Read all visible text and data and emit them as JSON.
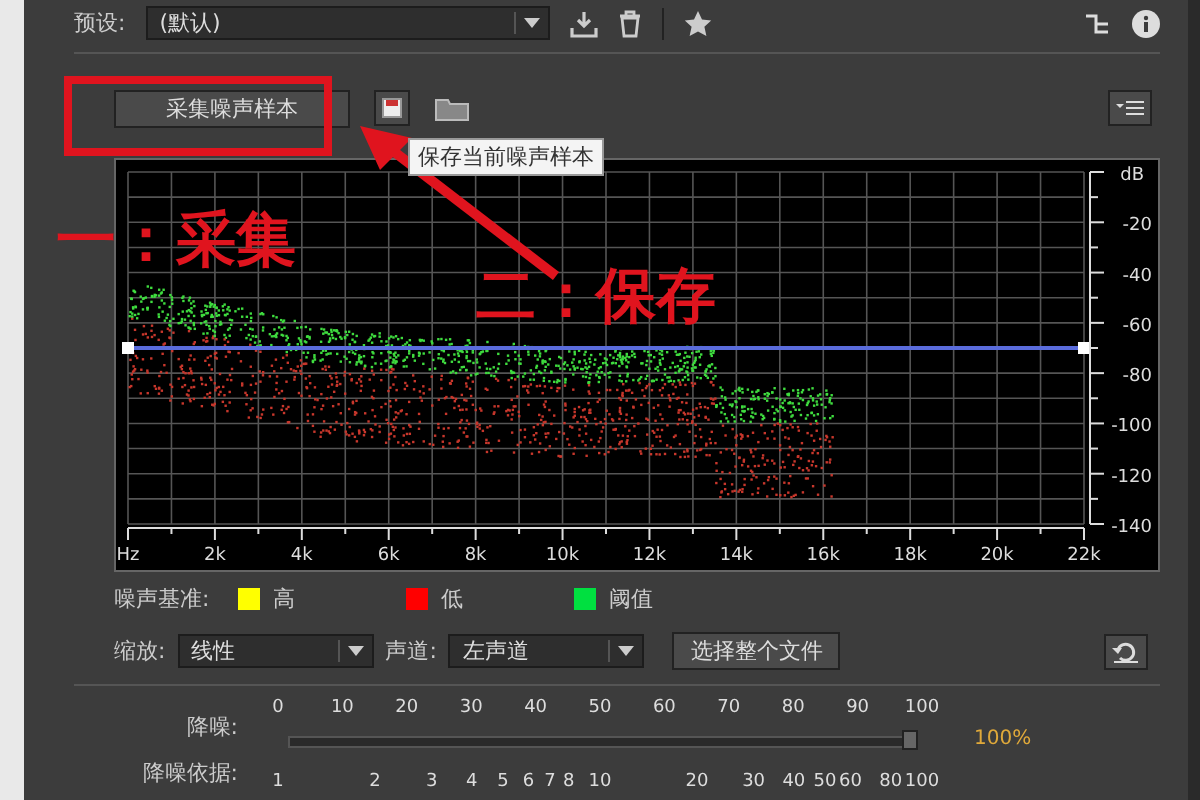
{
  "preset": {
    "label": "预设:",
    "value": "(默认)"
  },
  "noise_print": {
    "capture_button": "采集噪声样本",
    "tooltip": "保存当前噪声样本"
  },
  "spectrum": {
    "y_unit": "dB",
    "y_labels": [
      "-20",
      "-40",
      "-60",
      "-80",
      "-100",
      "-120",
      "-140"
    ],
    "x_labels": [
      "Hz",
      "2k",
      "4k",
      "6k",
      "8k",
      "10k",
      "12k",
      "14k",
      "16k",
      "18k",
      "20k",
      "22k"
    ]
  },
  "legend": {
    "label": "噪声基准:",
    "items": [
      {
        "text": "高",
        "color": "#ffff00"
      },
      {
        "text": "低",
        "color": "#ff0000"
      },
      {
        "text": "阈值",
        "color": "#00e040"
      }
    ]
  },
  "scale": {
    "label": "缩放:",
    "value": "线性"
  },
  "channel": {
    "label": "声道:",
    "value": "左声道"
  },
  "select_file_button": "选择整个文件",
  "noise_reduction": {
    "label": "降噪:",
    "ticks": [
      "0",
      "10",
      "20",
      "30",
      "40",
      "50",
      "60",
      "70",
      "80",
      "90",
      "100"
    ],
    "level": 1,
    "reading": "100%"
  },
  "reduce_by": {
    "label": "降噪依据:",
    "ticks": [
      "1",
      "2",
      "3",
      "4",
      "5",
      "6",
      "7",
      "8",
      "10",
      "20",
      "30",
      "40",
      "50",
      "60",
      "80",
      "100"
    ]
  },
  "annotations": [
    {
      "text": "一：采集"
    },
    {
      "text": "二：保存"
    }
  ]
}
